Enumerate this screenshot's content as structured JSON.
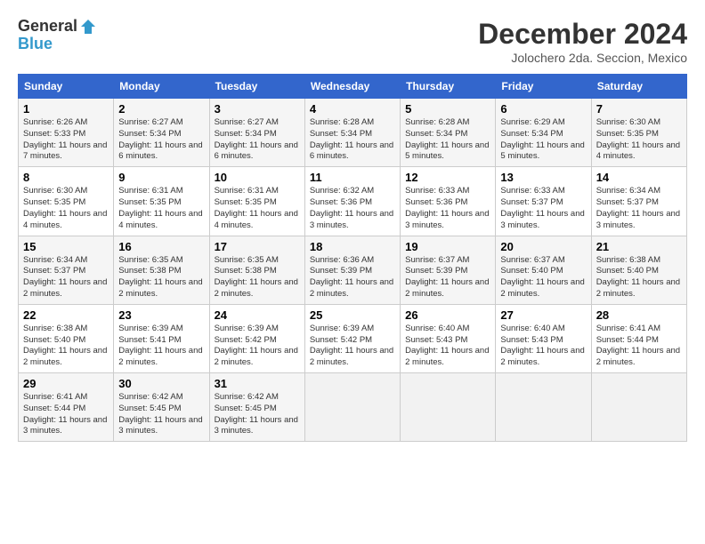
{
  "header": {
    "logo_general": "General",
    "logo_blue": "Blue",
    "month_title": "December 2024",
    "location": "Jolochero 2da. Seccion, Mexico"
  },
  "days_of_week": [
    "Sunday",
    "Monday",
    "Tuesday",
    "Wednesday",
    "Thursday",
    "Friday",
    "Saturday"
  ],
  "weeks": [
    [
      {
        "day": "1",
        "sunrise": "6:26 AM",
        "sunset": "5:33 PM",
        "daylight": "11 hours and 7 minutes."
      },
      {
        "day": "2",
        "sunrise": "6:27 AM",
        "sunset": "5:34 PM",
        "daylight": "11 hours and 6 minutes."
      },
      {
        "day": "3",
        "sunrise": "6:27 AM",
        "sunset": "5:34 PM",
        "daylight": "11 hours and 6 minutes."
      },
      {
        "day": "4",
        "sunrise": "6:28 AM",
        "sunset": "5:34 PM",
        "daylight": "11 hours and 6 minutes."
      },
      {
        "day": "5",
        "sunrise": "6:28 AM",
        "sunset": "5:34 PM",
        "daylight": "11 hours and 5 minutes."
      },
      {
        "day": "6",
        "sunrise": "6:29 AM",
        "sunset": "5:34 PM",
        "daylight": "11 hours and 5 minutes."
      },
      {
        "day": "7",
        "sunrise": "6:30 AM",
        "sunset": "5:35 PM",
        "daylight": "11 hours and 4 minutes."
      }
    ],
    [
      {
        "day": "8",
        "sunrise": "6:30 AM",
        "sunset": "5:35 PM",
        "daylight": "11 hours and 4 minutes."
      },
      {
        "day": "9",
        "sunrise": "6:31 AM",
        "sunset": "5:35 PM",
        "daylight": "11 hours and 4 minutes."
      },
      {
        "day": "10",
        "sunrise": "6:31 AM",
        "sunset": "5:35 PM",
        "daylight": "11 hours and 4 minutes."
      },
      {
        "day": "11",
        "sunrise": "6:32 AM",
        "sunset": "5:36 PM",
        "daylight": "11 hours and 3 minutes."
      },
      {
        "day": "12",
        "sunrise": "6:33 AM",
        "sunset": "5:36 PM",
        "daylight": "11 hours and 3 minutes."
      },
      {
        "day": "13",
        "sunrise": "6:33 AM",
        "sunset": "5:37 PM",
        "daylight": "11 hours and 3 minutes."
      },
      {
        "day": "14",
        "sunrise": "6:34 AM",
        "sunset": "5:37 PM",
        "daylight": "11 hours and 3 minutes."
      }
    ],
    [
      {
        "day": "15",
        "sunrise": "6:34 AM",
        "sunset": "5:37 PM",
        "daylight": "11 hours and 2 minutes."
      },
      {
        "day": "16",
        "sunrise": "6:35 AM",
        "sunset": "5:38 PM",
        "daylight": "11 hours and 2 minutes."
      },
      {
        "day": "17",
        "sunrise": "6:35 AM",
        "sunset": "5:38 PM",
        "daylight": "11 hours and 2 minutes."
      },
      {
        "day": "18",
        "sunrise": "6:36 AM",
        "sunset": "5:39 PM",
        "daylight": "11 hours and 2 minutes."
      },
      {
        "day": "19",
        "sunrise": "6:37 AM",
        "sunset": "5:39 PM",
        "daylight": "11 hours and 2 minutes."
      },
      {
        "day": "20",
        "sunrise": "6:37 AM",
        "sunset": "5:40 PM",
        "daylight": "11 hours and 2 minutes."
      },
      {
        "day": "21",
        "sunrise": "6:38 AM",
        "sunset": "5:40 PM",
        "daylight": "11 hours and 2 minutes."
      }
    ],
    [
      {
        "day": "22",
        "sunrise": "6:38 AM",
        "sunset": "5:40 PM",
        "daylight": "11 hours and 2 minutes."
      },
      {
        "day": "23",
        "sunrise": "6:39 AM",
        "sunset": "5:41 PM",
        "daylight": "11 hours and 2 minutes."
      },
      {
        "day": "24",
        "sunrise": "6:39 AM",
        "sunset": "5:42 PM",
        "daylight": "11 hours and 2 minutes."
      },
      {
        "day": "25",
        "sunrise": "6:39 AM",
        "sunset": "5:42 PM",
        "daylight": "11 hours and 2 minutes."
      },
      {
        "day": "26",
        "sunrise": "6:40 AM",
        "sunset": "5:43 PM",
        "daylight": "11 hours and 2 minutes."
      },
      {
        "day": "27",
        "sunrise": "6:40 AM",
        "sunset": "5:43 PM",
        "daylight": "11 hours and 2 minutes."
      },
      {
        "day": "28",
        "sunrise": "6:41 AM",
        "sunset": "5:44 PM",
        "daylight": "11 hours and 2 minutes."
      }
    ],
    [
      {
        "day": "29",
        "sunrise": "6:41 AM",
        "sunset": "5:44 PM",
        "daylight": "11 hours and 3 minutes."
      },
      {
        "day": "30",
        "sunrise": "6:42 AM",
        "sunset": "5:45 PM",
        "daylight": "11 hours and 3 minutes."
      },
      {
        "day": "31",
        "sunrise": "6:42 AM",
        "sunset": "5:45 PM",
        "daylight": "11 hours and 3 minutes."
      },
      null,
      null,
      null,
      null
    ]
  ],
  "labels": {
    "sunrise": "Sunrise:",
    "sunset": "Sunset:",
    "daylight": "Daylight:"
  }
}
